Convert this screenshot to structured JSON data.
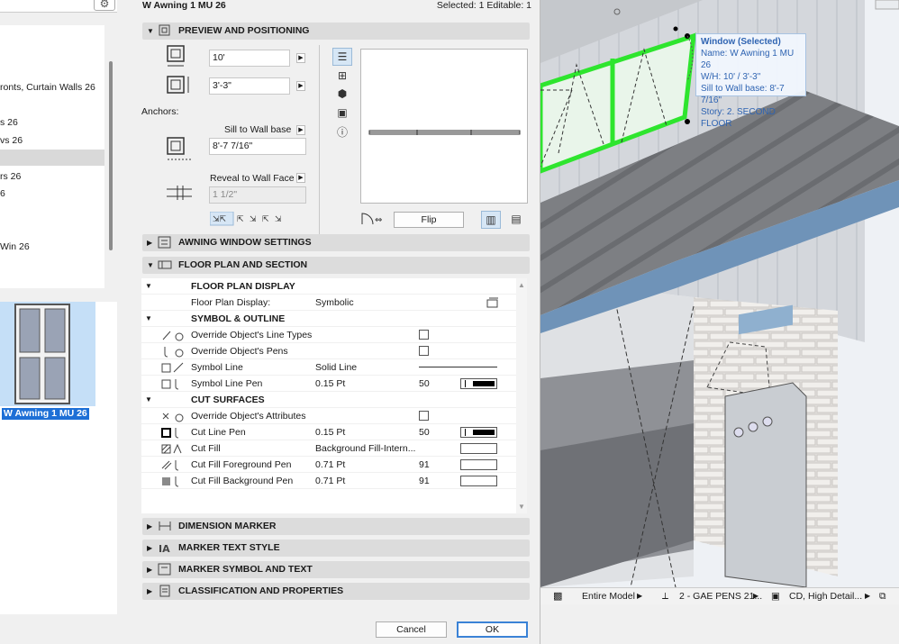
{
  "left_panel": {
    "tree_items": [
      "ronts, Curtain Walls 26",
      "s 26",
      "vs 26",
      "",
      "rs 26",
      "6",
      "Win 26"
    ],
    "thumbnail_caption": "W Awning 1 MU 26"
  },
  "dialog": {
    "title": "W Awning 1 MU 26",
    "selection_status": "Selected: 1 Editable: 1",
    "preview": {
      "section_label": "PREVIEW AND POSITIONING",
      "width_value": "10'",
      "height_value": "3'-3\"",
      "anchors_label": "Anchors:",
      "sill_anchor_label": "Sill to Wall base",
      "sill_value": "8'-7 7/16\"",
      "reveal_anchor_label": "Reveal to Wall Face",
      "reveal_value": "1 1/2\"",
      "flip_button": "Flip"
    },
    "sections_collapsed_top": [
      {
        "label": "AWNING WINDOW SETTINGS"
      }
    ],
    "floor_plan": {
      "section_label": "FLOOR PLAN AND SECTION",
      "rows": [
        {
          "type": "group",
          "name": "FLOOR PLAN DISPLAY"
        },
        {
          "type": "item",
          "name": "Floor Plan Display:",
          "value": "Symbolic"
        },
        {
          "type": "group",
          "name": "SYMBOL & OUTLINE"
        },
        {
          "type": "item",
          "name": "Override Object's Line Types",
          "checkbox": true
        },
        {
          "type": "item",
          "name": "Override Object's Pens",
          "checkbox": true
        },
        {
          "type": "item",
          "name": "Symbol Line",
          "value": "Solid Line"
        },
        {
          "type": "item",
          "name": "Symbol Line Pen",
          "value": "0.15 Pt",
          "num": "50"
        },
        {
          "type": "group",
          "name": "CUT SURFACES"
        },
        {
          "type": "item",
          "name": "Override Object's Attributes",
          "checkbox": true
        },
        {
          "type": "item",
          "name": "Cut Line Pen",
          "value": "0.15 Pt",
          "num": "50"
        },
        {
          "type": "item",
          "name": "Cut Fill",
          "value": "Background Fill-Intern..."
        },
        {
          "type": "item",
          "name": "Cut Fill Foreground Pen",
          "value": "0.71 Pt",
          "num": "91"
        },
        {
          "type": "item",
          "name": "Cut Fill Background Pen",
          "value": "0.71 Pt",
          "num": "91"
        }
      ]
    },
    "sections_collapsed_bottom": [
      {
        "label": "DIMENSION MARKER"
      },
      {
        "label": "MARKER TEXT STYLE"
      },
      {
        "label": "MARKER SYMBOL AND TEXT"
      },
      {
        "label": "CLASSIFICATION AND PROPERTIES"
      }
    ],
    "cancel_button": "Cancel",
    "ok_button": "OK"
  },
  "view3d": {
    "tooltip": {
      "title": "Window (Selected)",
      "name": "Name: W Awning 1 MU 26",
      "wh": "W/H: 10' / 3'-3\"",
      "sill": "Sill to Wall base: 8'-7 7/16\"",
      "story": "Story: 2. SECOND FLOOR"
    },
    "status": {
      "model": "Entire Model",
      "pens": "2 - GAE PENS 21...",
      "detail": "CD, High Detail..."
    }
  },
  "colors": {
    "accent": "#1d6fd6",
    "selection_green": "#2ee52e",
    "tooltip_text": "#2f64b2"
  }
}
